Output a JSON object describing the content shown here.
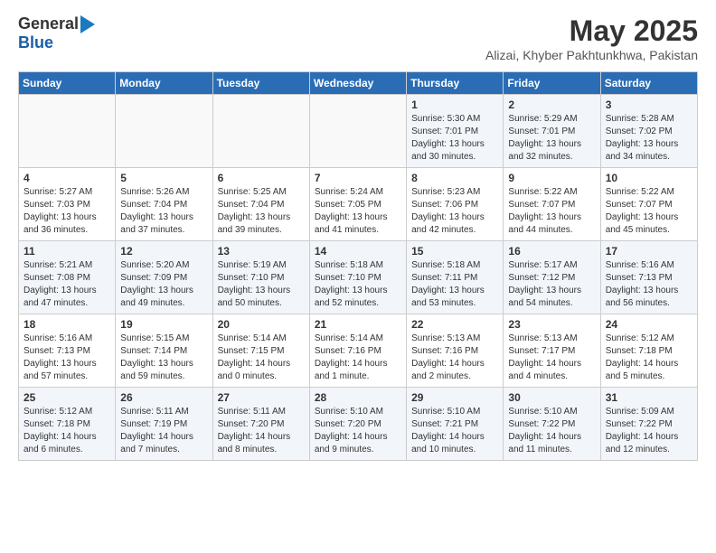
{
  "logo": {
    "general": "General",
    "blue": "Blue"
  },
  "title": {
    "month_year": "May 2025",
    "location": "Alizai, Khyber Pakhtunkhwa, Pakistan"
  },
  "header_days": [
    "Sunday",
    "Monday",
    "Tuesday",
    "Wednesday",
    "Thursday",
    "Friday",
    "Saturday"
  ],
  "weeks": [
    [
      {
        "day": "",
        "info": ""
      },
      {
        "day": "",
        "info": ""
      },
      {
        "day": "",
        "info": ""
      },
      {
        "day": "",
        "info": ""
      },
      {
        "day": "1",
        "info": "Sunrise: 5:30 AM\nSunset: 7:01 PM\nDaylight: 13 hours\nand 30 minutes."
      },
      {
        "day": "2",
        "info": "Sunrise: 5:29 AM\nSunset: 7:01 PM\nDaylight: 13 hours\nand 32 minutes."
      },
      {
        "day": "3",
        "info": "Sunrise: 5:28 AM\nSunset: 7:02 PM\nDaylight: 13 hours\nand 34 minutes."
      }
    ],
    [
      {
        "day": "4",
        "info": "Sunrise: 5:27 AM\nSunset: 7:03 PM\nDaylight: 13 hours\nand 36 minutes."
      },
      {
        "day": "5",
        "info": "Sunrise: 5:26 AM\nSunset: 7:04 PM\nDaylight: 13 hours\nand 37 minutes."
      },
      {
        "day": "6",
        "info": "Sunrise: 5:25 AM\nSunset: 7:04 PM\nDaylight: 13 hours\nand 39 minutes."
      },
      {
        "day": "7",
        "info": "Sunrise: 5:24 AM\nSunset: 7:05 PM\nDaylight: 13 hours\nand 41 minutes."
      },
      {
        "day": "8",
        "info": "Sunrise: 5:23 AM\nSunset: 7:06 PM\nDaylight: 13 hours\nand 42 minutes."
      },
      {
        "day": "9",
        "info": "Sunrise: 5:22 AM\nSunset: 7:07 PM\nDaylight: 13 hours\nand 44 minutes."
      },
      {
        "day": "10",
        "info": "Sunrise: 5:22 AM\nSunset: 7:07 PM\nDaylight: 13 hours\nand 45 minutes."
      }
    ],
    [
      {
        "day": "11",
        "info": "Sunrise: 5:21 AM\nSunset: 7:08 PM\nDaylight: 13 hours\nand 47 minutes."
      },
      {
        "day": "12",
        "info": "Sunrise: 5:20 AM\nSunset: 7:09 PM\nDaylight: 13 hours\nand 49 minutes."
      },
      {
        "day": "13",
        "info": "Sunrise: 5:19 AM\nSunset: 7:10 PM\nDaylight: 13 hours\nand 50 minutes."
      },
      {
        "day": "14",
        "info": "Sunrise: 5:18 AM\nSunset: 7:10 PM\nDaylight: 13 hours\nand 52 minutes."
      },
      {
        "day": "15",
        "info": "Sunrise: 5:18 AM\nSunset: 7:11 PM\nDaylight: 13 hours\nand 53 minutes."
      },
      {
        "day": "16",
        "info": "Sunrise: 5:17 AM\nSunset: 7:12 PM\nDaylight: 13 hours\nand 54 minutes."
      },
      {
        "day": "17",
        "info": "Sunrise: 5:16 AM\nSunset: 7:13 PM\nDaylight: 13 hours\nand 56 minutes."
      }
    ],
    [
      {
        "day": "18",
        "info": "Sunrise: 5:16 AM\nSunset: 7:13 PM\nDaylight: 13 hours\nand 57 minutes."
      },
      {
        "day": "19",
        "info": "Sunrise: 5:15 AM\nSunset: 7:14 PM\nDaylight: 13 hours\nand 59 minutes."
      },
      {
        "day": "20",
        "info": "Sunrise: 5:14 AM\nSunset: 7:15 PM\nDaylight: 14 hours\nand 0 minutes."
      },
      {
        "day": "21",
        "info": "Sunrise: 5:14 AM\nSunset: 7:16 PM\nDaylight: 14 hours\nand 1 minute."
      },
      {
        "day": "22",
        "info": "Sunrise: 5:13 AM\nSunset: 7:16 PM\nDaylight: 14 hours\nand 2 minutes."
      },
      {
        "day": "23",
        "info": "Sunrise: 5:13 AM\nSunset: 7:17 PM\nDaylight: 14 hours\nand 4 minutes."
      },
      {
        "day": "24",
        "info": "Sunrise: 5:12 AM\nSunset: 7:18 PM\nDaylight: 14 hours\nand 5 minutes."
      }
    ],
    [
      {
        "day": "25",
        "info": "Sunrise: 5:12 AM\nSunset: 7:18 PM\nDaylight: 14 hours\nand 6 minutes."
      },
      {
        "day": "26",
        "info": "Sunrise: 5:11 AM\nSunset: 7:19 PM\nDaylight: 14 hours\nand 7 minutes."
      },
      {
        "day": "27",
        "info": "Sunrise: 5:11 AM\nSunset: 7:20 PM\nDaylight: 14 hours\nand 8 minutes."
      },
      {
        "day": "28",
        "info": "Sunrise: 5:10 AM\nSunset: 7:20 PM\nDaylight: 14 hours\nand 9 minutes."
      },
      {
        "day": "29",
        "info": "Sunrise: 5:10 AM\nSunset: 7:21 PM\nDaylight: 14 hours\nand 10 minutes."
      },
      {
        "day": "30",
        "info": "Sunrise: 5:10 AM\nSunset: 7:22 PM\nDaylight: 14 hours\nand 11 minutes."
      },
      {
        "day": "31",
        "info": "Sunrise: 5:09 AM\nSunset: 7:22 PM\nDaylight: 14 hours\nand 12 minutes."
      }
    ]
  ]
}
